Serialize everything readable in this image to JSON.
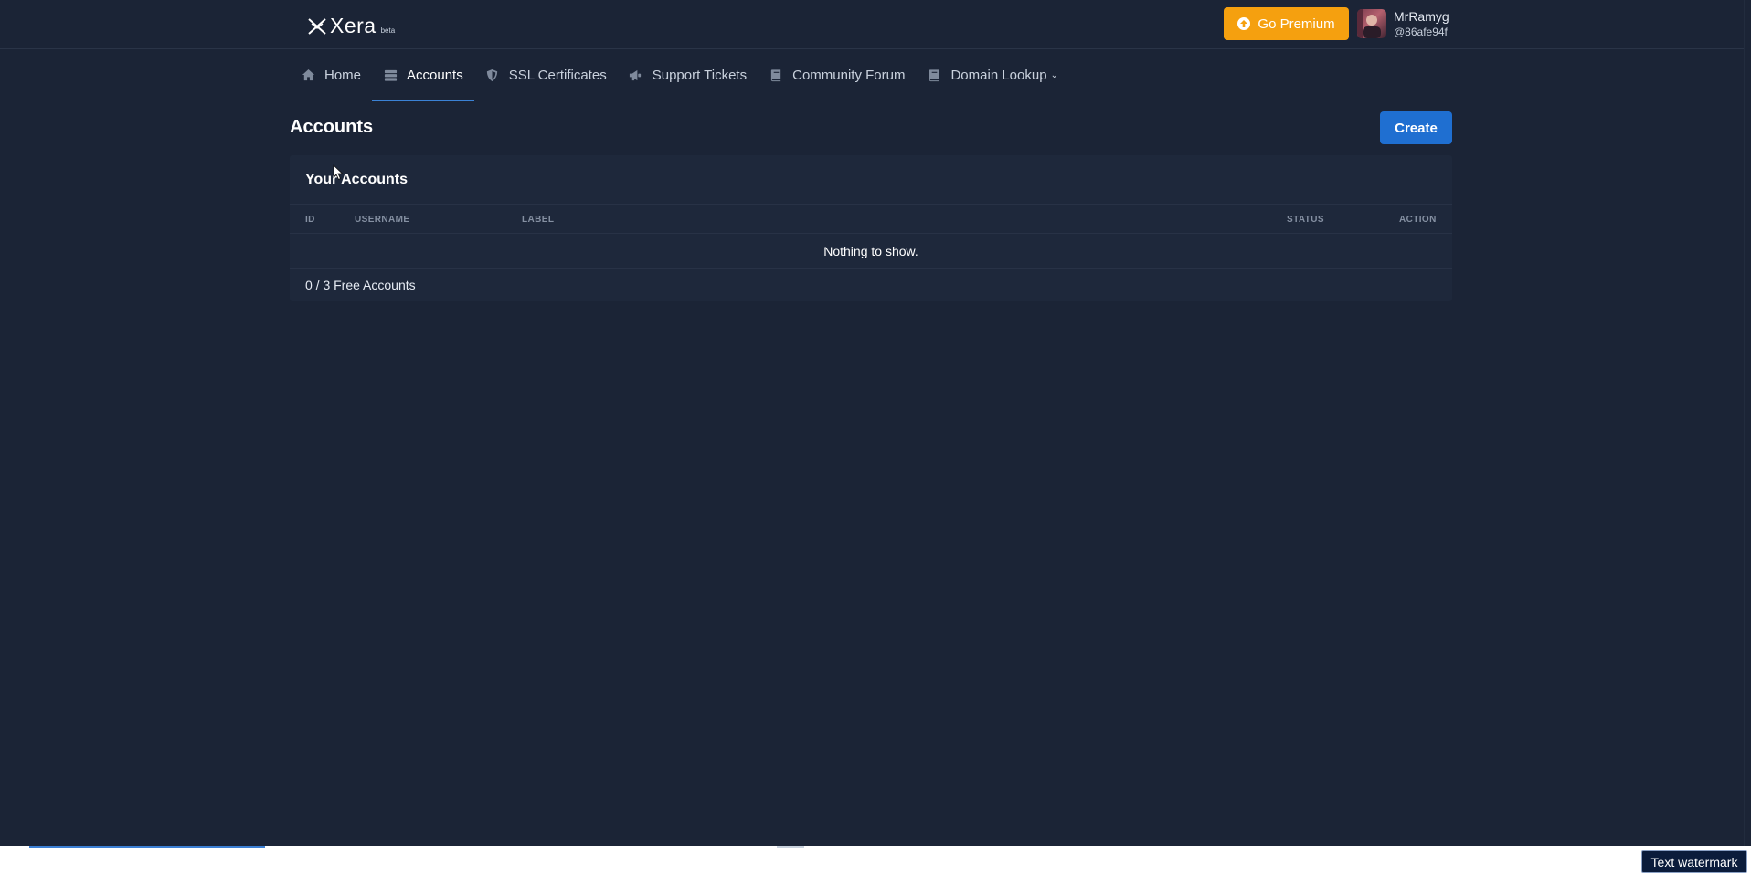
{
  "brand": {
    "name": "Xera",
    "tag": "beta"
  },
  "header": {
    "premium_label": "Go Premium",
    "user": {
      "name": "MrRamyg",
      "handle": "@86afe94f"
    }
  },
  "nav": {
    "items": [
      {
        "label": "Home",
        "icon": "home-icon"
      },
      {
        "label": "Accounts",
        "icon": "server-icon",
        "active": true
      },
      {
        "label": "SSL Certificates",
        "icon": "shield-icon"
      },
      {
        "label": "Support Tickets",
        "icon": "megaphone-icon"
      },
      {
        "label": "Community Forum",
        "icon": "book-icon"
      },
      {
        "label": "Domain Lookup",
        "icon": "book-icon",
        "dropdown": true
      }
    ]
  },
  "page": {
    "title": "Accounts",
    "create_label": "Create"
  },
  "accounts_card": {
    "title": "Your Accounts",
    "columns": [
      "ID",
      "USERNAME",
      "LABEL",
      "STATUS",
      "ACTION"
    ],
    "empty_message": "Nothing to show.",
    "footer": "0 / 3 Free Accounts"
  },
  "watermark": "Text watermark",
  "colors": {
    "background": "#1b2436",
    "card": "#1e283b",
    "premium": "#f5a00f",
    "primary": "#1f6fd1",
    "active_underline": "#3b82d6"
  }
}
